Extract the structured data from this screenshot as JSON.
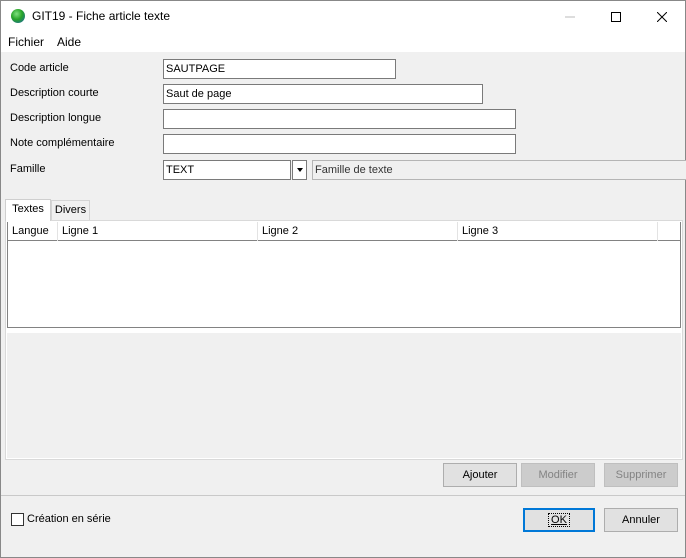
{
  "window": {
    "title": "GIT19 - Fiche article texte"
  },
  "menu": {
    "items": [
      "Fichier",
      "Aide"
    ]
  },
  "form": {
    "code_article": {
      "label": "Code article",
      "value": "SAUTPAGE"
    },
    "description_courte": {
      "label": "Description courte",
      "value": "Saut de page"
    },
    "description_longue": {
      "label": "Description longue",
      "value": ""
    },
    "note_complementaire": {
      "label": "Note complémentaire",
      "value": ""
    },
    "famille": {
      "label": "Famille",
      "value": "TEXT",
      "description": "Famille de texte"
    }
  },
  "tabs": [
    {
      "label": "Textes",
      "active": true
    },
    {
      "label": "Divers",
      "active": false
    }
  ],
  "grid": {
    "columns": [
      "Langue",
      "Ligne 1",
      "Ligne 2",
      "Ligne 3"
    ],
    "rows": []
  },
  "actions": {
    "ajouter": "Ajouter",
    "modifier": "Modifier",
    "supprimer": "Supprimer"
  },
  "footer": {
    "creation_serie": {
      "label": "Création en série",
      "checked": false
    },
    "ok": "OK",
    "annuler": "Annuler"
  },
  "colors": {
    "focus_border": "#0078d7",
    "disabled_text": "#838383"
  },
  "icons": {
    "app": "globe-icon",
    "minimize": "minimize-icon",
    "maximize": "maximize-icon",
    "close": "close-icon",
    "dropdown": "chevron-down-icon"
  }
}
